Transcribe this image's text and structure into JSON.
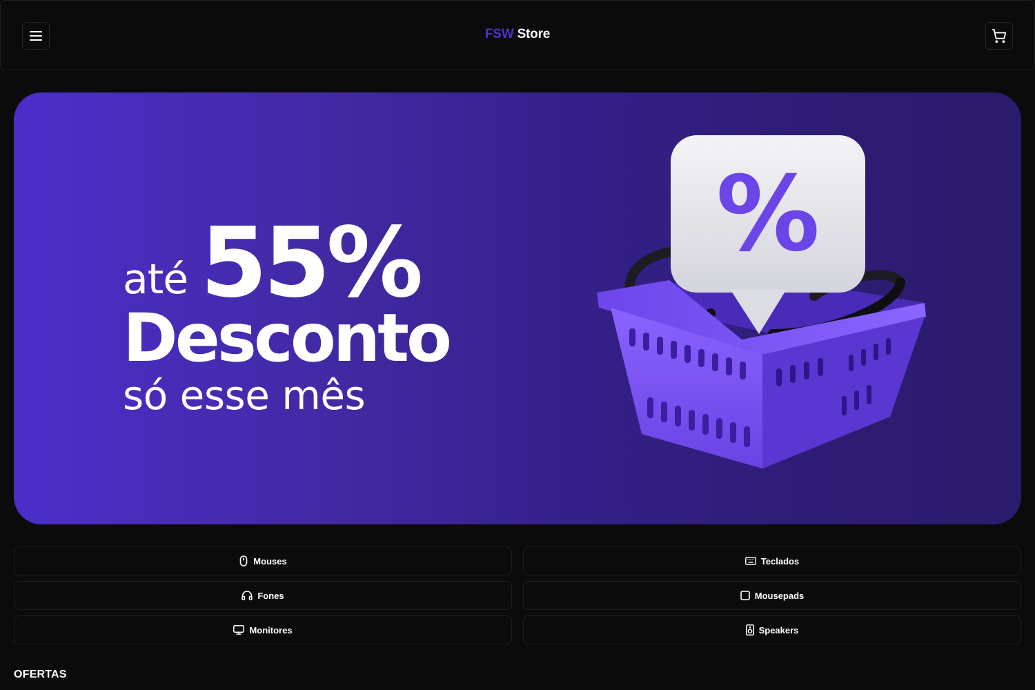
{
  "header": {
    "brand": "FSW",
    "store": " Store",
    "menu_icon": "hamburger-menu-icon",
    "cart_icon": "shopping-cart-icon"
  },
  "banner": {
    "prefix": "até",
    "percent": "55%",
    "headline": "Desconto",
    "subline": "só esse mês",
    "badge_symbol": "%",
    "colors": {
      "gradient_start": "#4b2ec9",
      "gradient_end": "#2b1b6c",
      "basket": "#7b55f0"
    }
  },
  "categories": [
    {
      "label": "Mouses",
      "icon": "mouse-icon"
    },
    {
      "label": "Teclados",
      "icon": "keyboard-icon"
    },
    {
      "label": "Fones",
      "icon": "headphones-icon"
    },
    {
      "label": "Mousepads",
      "icon": "square-icon"
    },
    {
      "label": "Monitores",
      "icon": "monitor-icon"
    },
    {
      "label": "Speakers",
      "icon": "speaker-icon"
    }
  ],
  "sections": {
    "offers_title": "OFERTAS"
  },
  "colors": {
    "background": "#0b0b0b",
    "accent": "#5033c3",
    "border": "#1f1f1f"
  }
}
